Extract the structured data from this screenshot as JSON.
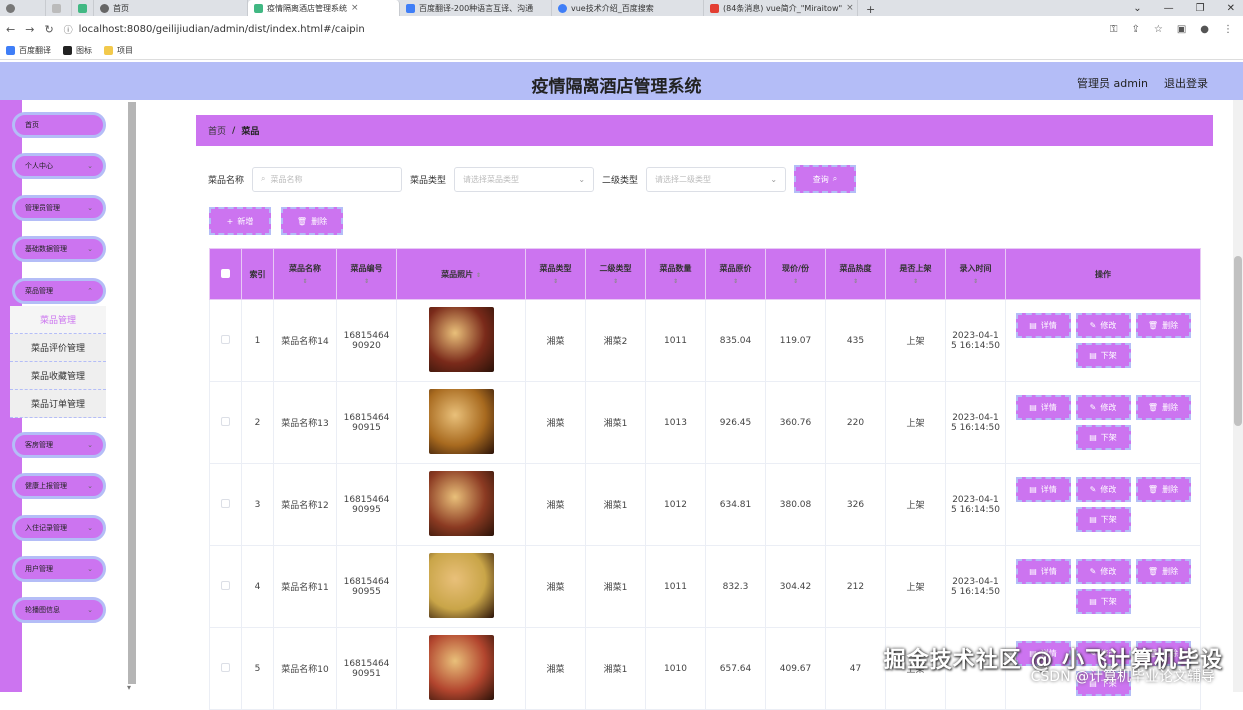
{
  "browser": {
    "tabs": [
      {
        "label": "首页",
        "color": "#4c8bf5",
        "active": false
      },
      {
        "label": "疫情隔离酒店管理系统",
        "color": "#41b883",
        "active": true
      },
      {
        "label": "百度翻译-200种语言互译、沟通",
        "color": "#3f7ef7",
        "active": false
      },
      {
        "label": "vue技术介绍_百度搜索",
        "color": "#3f7ef7",
        "active": false
      },
      {
        "label": "(84条消息) vue简介_\"Miraitow\"",
        "color": "#e33e32",
        "active": false
      }
    ],
    "url": "localhost:8080/geilijiudian/admin/dist/index.html#/caipin",
    "bookmarks": [
      "百度翻译",
      "图标",
      "项目"
    ]
  },
  "header": {
    "title": "疫情隔离酒店管理系统",
    "user": "管理员 admin",
    "logout": "退出登录"
  },
  "sidebar": {
    "items": [
      "首页",
      "个人中心",
      "管理员管理",
      "基础数据管理",
      "菜品管理",
      "客房管理",
      "健康上报管理",
      "入住记录管理",
      "用户管理",
      "轮播图信息"
    ],
    "submenu": [
      "菜品管理",
      "菜品评价管理",
      "菜品收藏管理",
      "菜品订单管理"
    ]
  },
  "breadcrumb": {
    "home": "首页",
    "separator": "/",
    "current": "菜品"
  },
  "search": {
    "name_label": "菜品名称",
    "name_placeholder": "菜品名称",
    "type_label": "菜品类型",
    "type_placeholder": "请选择菜品类型",
    "subtype_label": "二级类型",
    "subtype_placeholder": "请选择二级类型",
    "query_button": "查询"
  },
  "actions": {
    "add": "新增",
    "delete": "删除"
  },
  "table": {
    "headers": [
      "索引",
      "菜品名称",
      "菜品编号",
      "菜品照片",
      "菜品类型",
      "二级类型",
      "菜品数量",
      "菜品原价",
      "现价/份",
      "菜品热度",
      "是否上架",
      "录入时间",
      "操作"
    ],
    "op_labels": {
      "detail": "详情",
      "edit": "修改",
      "delete": "删除",
      "off": "下架"
    },
    "rows": [
      {
        "index": "1",
        "name": "菜品名称14",
        "code": "1681546490920",
        "type": "湘菜",
        "subtype": "湘菜2",
        "qty": "1011",
        "orig": "835.04",
        "price": "119.07",
        "heat": "435",
        "status": "上架",
        "time": "2023-04-15 16:14:50",
        "img": "#7a2a1a"
      },
      {
        "index": "2",
        "name": "菜品名称13",
        "code": "1681546490915",
        "type": "湘菜",
        "subtype": "湘菜1",
        "qty": "1013",
        "orig": "926.45",
        "price": "360.76",
        "heat": "220",
        "status": "上架",
        "time": "2023-04-15 16:14:50",
        "img": "#a86a1f"
      },
      {
        "index": "3",
        "name": "菜品名称12",
        "code": "1681546490995",
        "type": "湘菜",
        "subtype": "湘菜1",
        "qty": "1012",
        "orig": "634.81",
        "price": "380.08",
        "heat": "326",
        "status": "上架",
        "time": "2023-04-15 16:14:50",
        "img": "#8b3a22"
      },
      {
        "index": "4",
        "name": "菜品名称11",
        "code": "1681546490955",
        "type": "湘菜",
        "subtype": "湘菜1",
        "qty": "1011",
        "orig": "832.3",
        "price": "304.42",
        "heat": "212",
        "status": "上架",
        "time": "2023-04-15 16:14:50",
        "img": "#c9a548"
      },
      {
        "index": "5",
        "name": "菜品名称10",
        "code": "1681546490951",
        "type": "湘菜",
        "subtype": "湘菜1",
        "qty": "1010",
        "orig": "657.64",
        "price": "409.67",
        "heat": "47",
        "status": "上架",
        "time": "",
        "img": "#b2452e"
      }
    ]
  },
  "watermark": {
    "line1": "掘金技术社区 @ 小飞计算机毕设",
    "line2": "CSDN @计算机毕业论文辅导"
  },
  "colors": {
    "accent": "#cc74f0",
    "header_bg": "#b4bdf7"
  }
}
